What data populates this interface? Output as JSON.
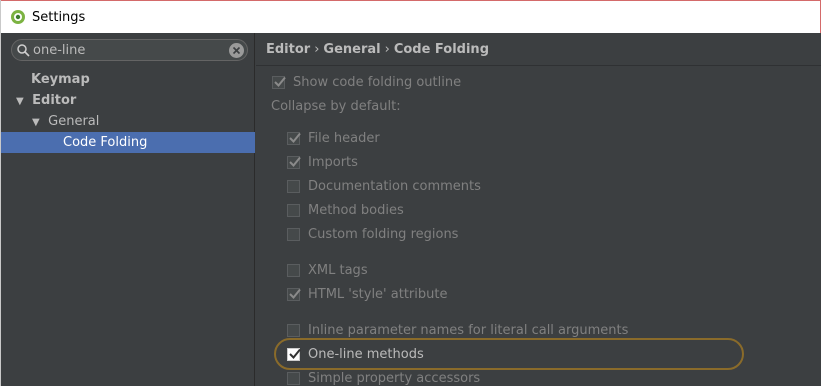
{
  "window": {
    "title": "Settings"
  },
  "search": {
    "value": "one-line"
  },
  "tree": {
    "keymap": "Keymap",
    "editor": "Editor",
    "general": "General",
    "code_folding": "Code Folding"
  },
  "breadcrumb": {
    "part1": "Editor",
    "part2": "General",
    "part3": "Code Folding",
    "separator": "›"
  },
  "options": {
    "show_outline": {
      "label": "Show code folding outline",
      "checked": true
    },
    "collapse_label": "Collapse by default:",
    "file_header": {
      "label": "File header",
      "checked": true
    },
    "imports": {
      "label": "Imports",
      "checked": true
    },
    "doc_comments": {
      "label": "Documentation comments",
      "checked": false
    },
    "method_bodies": {
      "label": "Method bodies",
      "checked": false
    },
    "custom_regions": {
      "label": "Custom folding regions",
      "checked": false
    },
    "xml_tags": {
      "label": "XML tags",
      "checked": false
    },
    "html_style": {
      "label": "HTML 'style' attribute",
      "checked": true
    },
    "inline_params": {
      "label": "Inline parameter names for literal call arguments",
      "checked": false
    },
    "one_line_methods": {
      "label": "One-line methods",
      "checked": true
    },
    "simple_accessors": {
      "label": "Simple property accessors",
      "checked": false
    }
  },
  "icons": {
    "app": "android-studio-icon",
    "search": "search-icon",
    "clear": "clear-icon",
    "check": "checkmark-icon"
  }
}
